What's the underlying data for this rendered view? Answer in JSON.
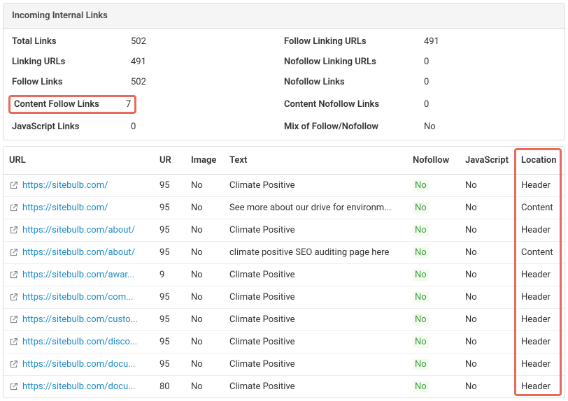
{
  "panel": {
    "title": "Incoming Internal Links",
    "stats": [
      {
        "leftLabel": "Total Links",
        "leftValue": "502",
        "rightLabel": "Follow Linking URLs",
        "rightValue": "491"
      },
      {
        "leftLabel": "Linking URLs",
        "leftValue": "491",
        "rightLabel": "Nofollow Linking URLs",
        "rightValue": "0"
      },
      {
        "leftLabel": "Follow Links",
        "leftValue": "502",
        "rightLabel": "Nofollow Links",
        "rightValue": "0"
      },
      {
        "leftLabel": "Content Follow Links",
        "leftValue": "7",
        "rightLabel": "Content Nofollow Links",
        "rightValue": "0",
        "highlightLeft": true
      },
      {
        "leftLabel": "JavaScript Links",
        "leftValue": "0",
        "rightLabel": "Mix of Follow/Nofollow",
        "rightValue": "No"
      }
    ]
  },
  "table": {
    "headers": {
      "url": "URL",
      "ur": "UR",
      "image": "Image",
      "text": "Text",
      "nofollow": "Nofollow",
      "javascript": "JavaScript",
      "location": "Location"
    },
    "rows": [
      {
        "url": "https://sitebulb.com/",
        "ur": "95",
        "image": "No",
        "text": "Climate Positive",
        "nofollow": "No",
        "javascript": "No",
        "location": "Header"
      },
      {
        "url": "https://sitebulb.com/",
        "ur": "95",
        "image": "No",
        "text": "See more about our drive for environm...",
        "nofollow": "No",
        "javascript": "No",
        "location": "Content"
      },
      {
        "url": "https://sitebulb.com/about/",
        "ur": "95",
        "image": "No",
        "text": "Climate Positive",
        "nofollow": "No",
        "javascript": "No",
        "location": "Header"
      },
      {
        "url": "https://sitebulb.com/about/",
        "ur": "95",
        "image": "No",
        "text": "climate positive SEO auditing page here",
        "nofollow": "No",
        "javascript": "No",
        "location": "Content"
      },
      {
        "url": "https://sitebulb.com/awar...",
        "ur": "9",
        "image": "No",
        "text": "Climate Positive",
        "nofollow": "No",
        "javascript": "No",
        "location": "Header"
      },
      {
        "url": "https://sitebulb.com/com...",
        "ur": "95",
        "image": "No",
        "text": "Climate Positive",
        "nofollow": "No",
        "javascript": "No",
        "location": "Header"
      },
      {
        "url": "https://sitebulb.com/custo...",
        "ur": "95",
        "image": "No",
        "text": "Climate Positive",
        "nofollow": "No",
        "javascript": "No",
        "location": "Header"
      },
      {
        "url": "https://sitebulb.com/disco...",
        "ur": "95",
        "image": "No",
        "text": "Climate Positive",
        "nofollow": "No",
        "javascript": "No",
        "location": "Header"
      },
      {
        "url": "https://sitebulb.com/docu...",
        "ur": "95",
        "image": "No",
        "text": "Climate Positive",
        "nofollow": "No",
        "javascript": "No",
        "location": "Header"
      },
      {
        "url": "https://sitebulb.com/docu...",
        "ur": "80",
        "image": "No",
        "text": "Climate Positive",
        "nofollow": "No",
        "javascript": "No",
        "location": "Header"
      }
    ]
  }
}
